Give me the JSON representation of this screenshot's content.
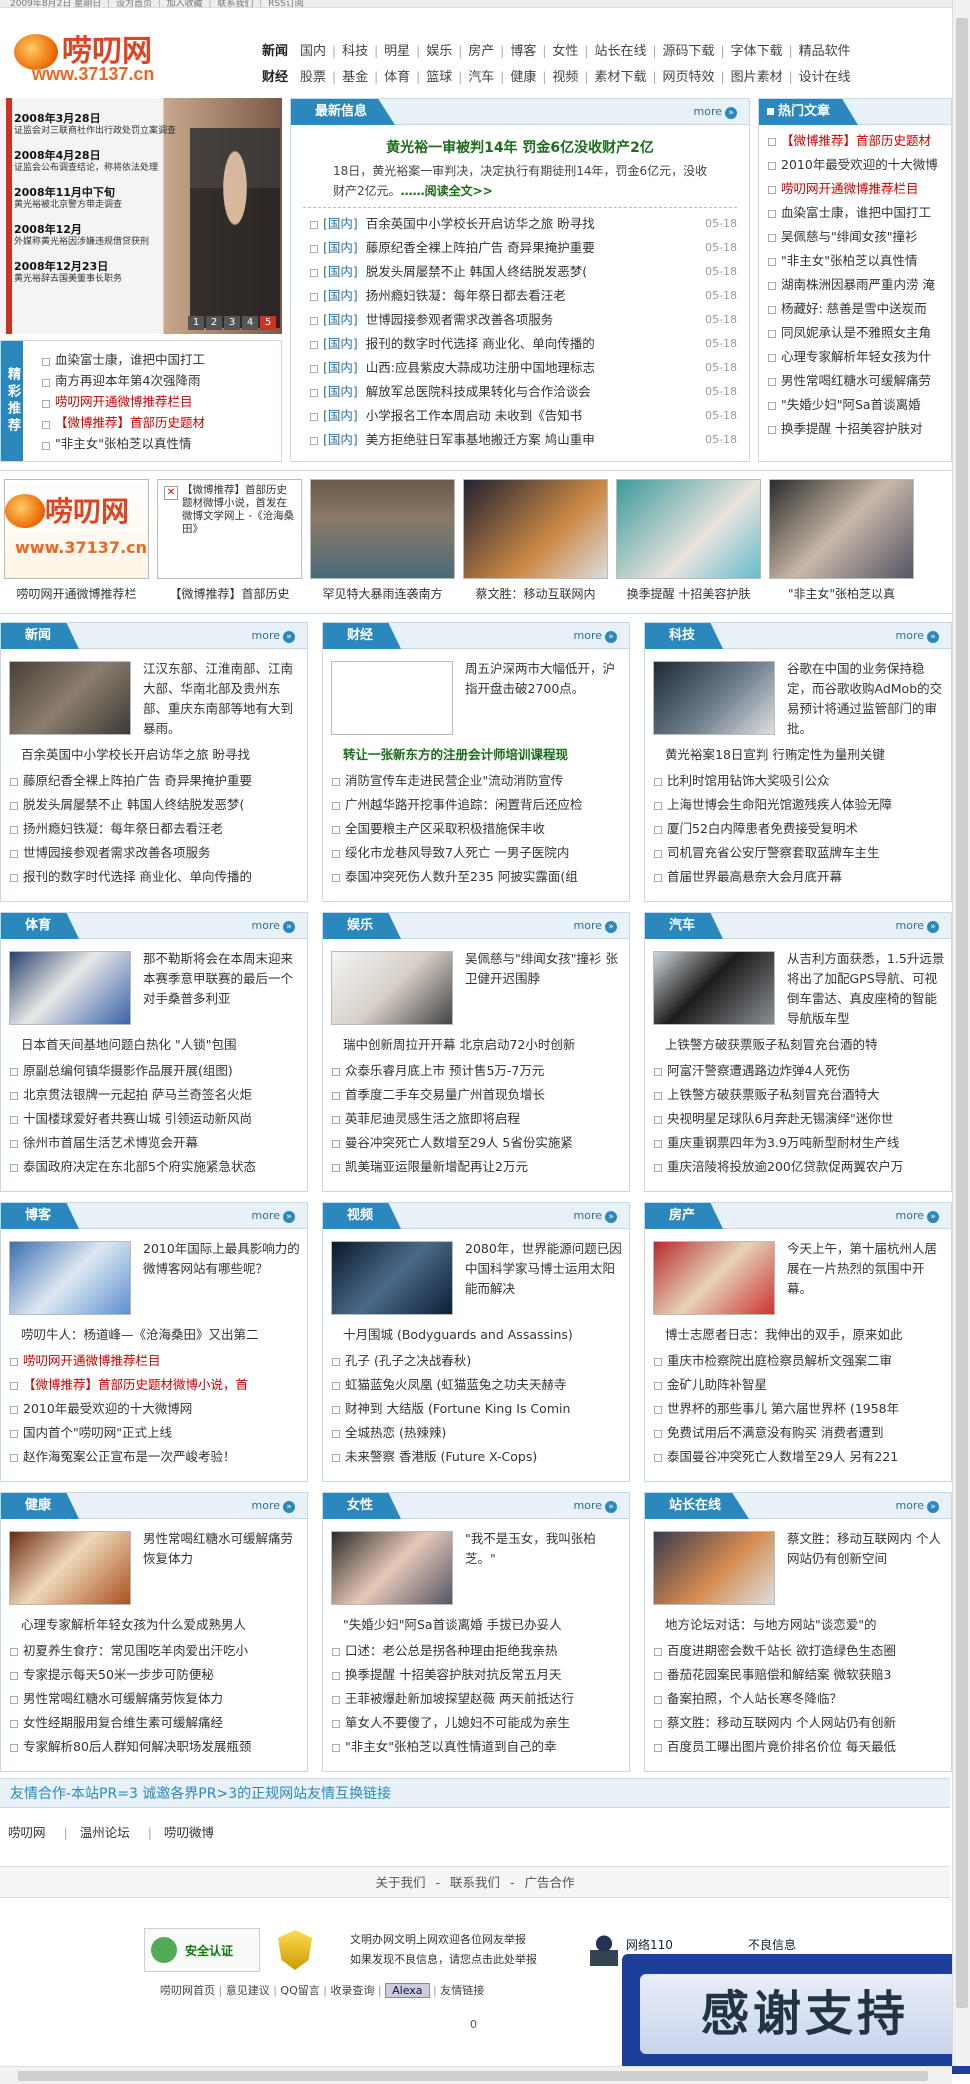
{
  "top_strip": "2009年8月2日 星期日 ｜ 设为首页 ｜ 加入收藏 ｜ 联系我们 ｜ RSS订阅",
  "logo": {
    "title": "唠叨网",
    "domain": "www.37137.cn"
  },
  "nav": {
    "row1": {
      "cat": "新闻",
      "items": [
        "国内",
        "科技",
        "明星",
        "娱乐",
        "房产",
        "博客",
        "女性",
        "站长在线",
        "源码下载",
        "字体下载",
        "精品软件"
      ]
    },
    "row2": {
      "cat": "财经",
      "items": [
        "股票",
        "基金",
        "体育",
        "篮球",
        "汽车",
        "健康",
        "视频",
        "素材下载",
        "网页特效",
        "图片素材",
        "设计在线"
      ]
    }
  },
  "slideshow": {
    "entries": [
      {
        "date": "2008年3月28日",
        "text": "证监会对三联商社作出行政处罚立案调查"
      },
      {
        "date": "2008年4月28日",
        "text": "证监会公布调查结论，称将依法处理"
      },
      {
        "date": "2008年11月中下旬",
        "text": "黄光裕被北京警方带走调查"
      },
      {
        "date": "2008年12月",
        "text": "外媒称黄光裕因涉嫌违规借贷获刑"
      },
      {
        "date": "2008年12月23日",
        "text": "黄光裕辞去国美董事长职务"
      }
    ],
    "pages": [
      "1",
      "2",
      "3",
      "4",
      "5"
    ]
  },
  "side_recommend": {
    "label": "精彩推荐",
    "items": [
      {
        "text": "血染富士康，谁把中国打工",
        "red": false
      },
      {
        "text": "南方再迎本年第4次强降雨",
        "red": false
      },
      {
        "text": "唠叨网开通微博推荐栏目",
        "red": true
      },
      {
        "text": "【微博推荐】首部历史题材",
        "red": true
      },
      {
        "text": "\"非主女\"张柏芝以真性情",
        "red": false
      }
    ]
  },
  "latest": {
    "title": "最新信息",
    "more": "more",
    "headline": "黄光裕一审被判14年 罚金6亿没收财产2亿",
    "summary": "18日，黄光裕案一审判决，决定执行有期徒刑14年，罚金6亿元，没收财产2亿元。",
    "read_all": "……阅读全文>>",
    "items": [
      {
        "cat": "[国内]",
        "text": "百余英国中小学校长开启访华之旅 盼寻找",
        "date": "05-18"
      },
      {
        "cat": "[国内]",
        "text": "藤原纪香全裸上阵拍广告 奇异果掩护重要",
        "date": "05-18"
      },
      {
        "cat": "[国内]",
        "text": "脱发头屑屡禁不止 韩国人终结脱发恶梦(",
        "date": "05-18"
      },
      {
        "cat": "[国内]",
        "text": "扬州瘾妇铁凝：每年祭日都去看汪老",
        "date": "05-18"
      },
      {
        "cat": "[国内]",
        "text": "世博园接参观者需求改善各项服务",
        "date": "05-18"
      },
      {
        "cat": "[国内]",
        "text": "报刊的数字时代选择 商业化、单向传播的",
        "date": "05-18"
      },
      {
        "cat": "[国内]",
        "text": "山西:应县紫皮大蒜成功注册中国地理标志",
        "date": "05-18"
      },
      {
        "cat": "[国内]",
        "text": "解放军总医院科技成果转化与合作洽谈会",
        "date": "05-18"
      },
      {
        "cat": "[国内]",
        "text": "小学报名工作本周启动 未收到《告知书",
        "date": "05-18"
      },
      {
        "cat": "[国内]",
        "text": "美方拒绝驻日军事基地搬迁方案 鸠山重申",
        "date": "05-18"
      }
    ]
  },
  "hot": {
    "title": "热门文章",
    "items": [
      {
        "text": "【微博推荐】首部历史题材",
        "red": true
      },
      {
        "text": "2010年最受欢迎的十大微博",
        "red": false
      },
      {
        "text": "唠叨网开通微博推荐栏目",
        "red": true
      },
      {
        "text": "血染富士康，谁把中国打工",
        "red": false
      },
      {
        "text": "吴佩慈与\"绯闻女孩\"撞衫",
        "red": false
      },
      {
        "text": "\"非主女\"张柏芝以真性情",
        "red": false
      },
      {
        "text": "湖南株洲因暴雨严重内涝 淹",
        "red": false
      },
      {
        "text": "杨藏好: 慈善是雪中送炭而",
        "red": false
      },
      {
        "text": "同凤妮承认是不雅照女主角",
        "red": false
      },
      {
        "text": "心理专家解析年轻女孩为什",
        "red": false
      },
      {
        "text": "男性常喝红糖水可缓解痛劳",
        "red": false
      },
      {
        "text": "\"失婚少妇\"阿Sa首谈离婚",
        "red": false
      },
      {
        "text": "换季提醒 十招美容护肤对",
        "red": false
      }
    ]
  },
  "gallery": [
    {
      "caption": "唠叨网开通微博推荐栏"
    },
    {
      "caption": "【微博推荐】首部历史",
      "alt": "【微博推荐】首部历史题材微博小说，首发在微博文学网上 -《沧海桑田》"
    },
    {
      "caption": "罕见特大暴雨连袭南方"
    },
    {
      "caption": "蔡文胜：移动互联网内"
    },
    {
      "caption": "换季提醒 十招美容护肤"
    },
    {
      "caption": "\"非主女\"张柏芝以真"
    }
  ],
  "sections": [
    {
      "title": "新闻",
      "more": "more",
      "desc": "江汉东部、江淮南部、江南大部、华南北部及贵州东部、重庆东南部等地有大到暴雨。",
      "lead": "百余英国中小学校长开启访华之旅 盼寻找",
      "lead_green": false,
      "items": [
        "藤原纪香全裸上阵拍广告 奇异果掩护重要",
        "脱发头屑屡禁不止 韩国人终结脱发恶梦(",
        "扬州瘾妇铁凝：每年祭日都去看汪老",
        "世博园接参观者需求改善各项服务",
        "报刊的数字时代选择 商业化、单向传播的"
      ]
    },
    {
      "title": "财经",
      "more": "more",
      "desc": "周五沪深两市大幅低开，沪指开盘击破2700点。",
      "lead": "转让一张新东方的注册会计师培训课程现",
      "lead_green": true,
      "items": [
        "消防宣传车走进民营企业\"流动消防宣传",
        "广州越华路开挖事件追踪：闲置背后还应检",
        "全国要粮主产区采取积极措施保丰收",
        "绥化市龙巷风导致7人死亡 一男子医院内",
        "泰国冲突死伤人数升至235 阿披实露面(组"
      ]
    },
    {
      "title": "科技",
      "more": "more",
      "desc": "谷歌在中国的业务保持稳定，而谷歌收购AdMob的交易预计将通过监管部门的审批。",
      "lead": "黄光裕案18日宣判 行贿定性为量刑关键",
      "lead_green": false,
      "items": [
        "比利时馆用钻饰大奖吸引公众",
        "上海世博会生命阳光馆邀残疾人体验无障",
        "厦门52白内障患者免费接受复明术",
        "司机冒充省公安厅警察套取蓝牌车主生",
        "首届世界最高悬奈大会月底开幕"
      ]
    },
    {
      "title": "体育",
      "more": "more",
      "desc": "那不勒斯将会在本周末迎来本赛季意甲联赛的最后一个对手桑普多利亚",
      "lead": "日本首天间基地问题白热化 \"人锁\"包围",
      "lead_green": false,
      "items": [
        "原副总编何镇华摄影作品展开展(组图)",
        "北京贯法银牌一元起拍 萨马兰奇签名火炬",
        "十国楼球爱好者共赛山城 引领运动新风尚",
        "徐州市首届生活艺术博览会开幕",
        "泰国政府决定在东北部5个府实施紧急状态"
      ]
    },
    {
      "title": "娱乐",
      "more": "more",
      "desc": "吴佩慈与\"绯闻女孩\"撞衫 张卫健开迟围脖",
      "lead": "瑞中创新周拉开开幕 北京启动72小时创新",
      "lead_green": false,
      "items": [
        "众泰乐睿月底上市 预计售5万-7万元",
        "首季度二手车交易量广州首现负增长",
        "英菲尼迪灵感生活之旅即将启程",
        "曼谷冲突死亡人数增至29人 5省份实施紧",
        "凯美瑞亚运限量新增配再让2万元"
      ]
    },
    {
      "title": "汽车",
      "more": "more",
      "desc": "从吉利方面获悉，1.5升远景将出了加配GPS导航、可视倒车雷达、真皮座椅的智能导航版车型",
      "lead": "上铁警方破获票贩子私刻冒充台酒的特",
      "lead_green": false,
      "items": [
        "阿富汗警察遭遇路边炸弹4人死伤",
        "上铁警方破获票贩子私刻冒充台酒特大",
        "央视明星足球队6月奔赴无锡演绎\"迷你世",
        "重庆重钢票四年为3.9万吨新型耐材生产线",
        "重庆涪陵将投放逾200亿贷款促两翼农户万"
      ]
    },
    {
      "title": "博客",
      "more": "more",
      "desc": "2010年国际上最具影响力的微博客网站有哪些呢？",
      "lead": "唠叨牛人：杨道峰—《沧海桑田》又出第二",
      "lead_green": false,
      "items": [
        "唠叨网开通微博推荐栏目",
        "【微博推荐】首部历史题材微博小说，首",
        "2010年最受欢迎的十大微博网",
        "国内首个\"唠叨网\"正式上线",
        "赵作海冤案公正宣布是一次严峻考验！"
      ],
      "red_items": [
        0,
        1
      ]
    },
    {
      "title": "视频",
      "more": "more",
      "desc": "2080年，世界能源问题已因中国科学家马博士运用太阳能而解决",
      "lead": "十月围城 (Bodyguards and Assassins)",
      "lead_green": false,
      "items": [
        "孔子 (孔子之决战春秋)",
        "虹猫蓝兔火凤凰 (虹猫蓝兔之功夫天赫寺",
        "财神到 大结版 (Fortune King Is Comin",
        "全城热恋 (热辣辣)",
        "未来警察 香港版 (Future X-Cops)"
      ]
    },
    {
      "title": "房产",
      "more": "more",
      "desc": "今天上午，第十届杭州人居展在一片热烈的氛围中开幕。",
      "lead": "博士志愿者日志：我伸出的双手，原来如此",
      "lead_green": false,
      "items": [
        "重庆市检察院出庭检察员解析文强案二审",
        "金矿儿助阵补智星",
        "世界杯的那些事儿 第六届世界杯 (1958年",
        "免费试用后不满意没有购买 消费者遭到",
        "泰国曼谷冲突死亡人数增至29人 另有221"
      ]
    },
    {
      "title": "健康",
      "more": "more",
      "desc": "男性常喝红糖水可缓解痛劳恢复体力",
      "lead": "心理专家解析年轻女孩为什么爱成熟男人",
      "lead_green": false,
      "items": [
        "初夏养生食疗：常见围吃羊肉爱出汗吃小",
        "专家提示每天50米一步步可防便秘",
        "男性常喝红糖水可缓解痛劳恢复体力",
        "女性经期服用复合维生素可缓解痛经",
        "专家解析80后人群知何解决职场发展瓶颈"
      ]
    },
    {
      "title": "女性",
      "more": "more",
      "desc": "\"我不是玉女，我叫张柏芝。\"",
      "lead": "\"失婚少妇\"阿Sa首谈离婚 手拔已办妥人",
      "lead_green": false,
      "items": [
        "口述：老公总是拐各种理由拒绝我亲热",
        "换季提醒 十招美容护肤对抗反常五月天",
        "王菲被爆赴新加坡探望赵薇 两天前抵达行",
        "箪女人不要傻了，儿媳妇不可能成为亲生",
        "\"非主女\"张柏芝以真性情道到自己的幸"
      ]
    },
    {
      "title": "站长在线",
      "more": "more",
      "desc": "蔡文胜：移动互联网内 个人网站仍有创新空间",
      "lead": "地方论坛对话：与地方网站\"谈恋爱\"的",
      "lead_green": false,
      "items": [
        "百度进期密会数千站长 欲打造绿色生态圈",
        "番茄花园案民事赔偿和解结案 微软获赔3",
        "备案拍照，个人站长寒冬降临？",
        "蔡文胜：移动互联网内 个人网站仍有创新",
        "百度员工曝出图片竟价排名价位 每天最低"
      ]
    }
  ],
  "friendship": {
    "text": "友情合作-本站PR=3 诚邀各界PR>3的正规网站友情互换链接"
  },
  "friend_links": [
    "唠叨网",
    "温州论坛",
    "唠叨微博"
  ],
  "footer": {
    "about": "关于我们",
    "contact": "联系我们",
    "ads": "广告合作",
    "sep": "-"
  },
  "badges": {
    "safe": "安全认证",
    "wenming": "文明办网文明上网欢迎各位网友举报",
    "wenming2": "如果发现不良信息，请您点击此处举报",
    "police": "网络110",
    "bad": "不良信息"
  },
  "footlinks": [
    "唠叨网首页",
    "意见建议",
    "QQ留言",
    "收录查询",
    "Alexa",
    "友情链接"
  ],
  "counter": "0",
  "thanks": "感谢支持"
}
